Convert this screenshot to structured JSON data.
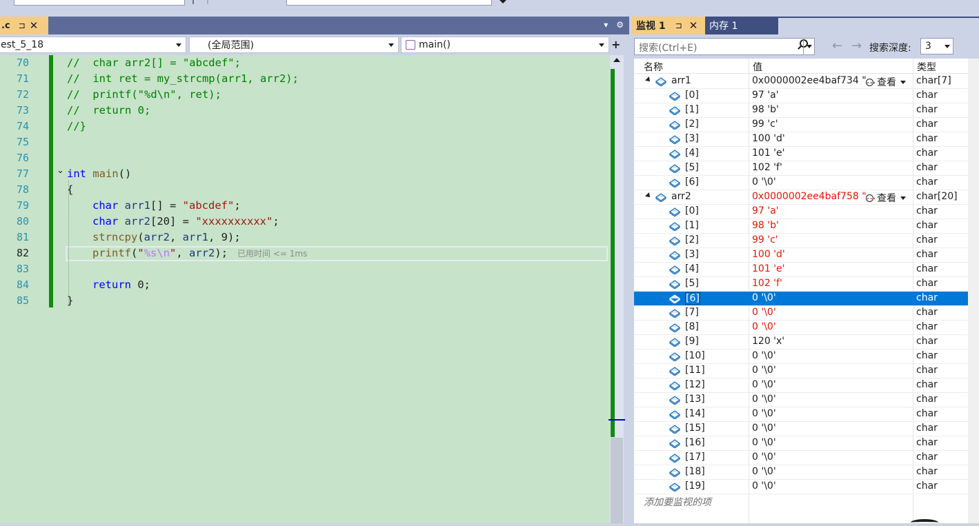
{
  "editor": {
    "file_tab": ".c",
    "nav_project": "est_5_18",
    "nav_scope": "(全局范围)",
    "nav_function": "main()",
    "lines": [
      {
        "n": "70",
        "text": "//  char arr2[] = \"abcdef\";"
      },
      {
        "n": "71",
        "text": "//  int ret = my_strcmp(arr1, arr2);"
      },
      {
        "n": "72",
        "text": "//  printf(\"%d\\n\", ret);"
      },
      {
        "n": "73",
        "text": "//  return 0;"
      },
      {
        "n": "74",
        "text": "//}"
      },
      {
        "n": "75",
        "text": ""
      },
      {
        "n": "76",
        "text": ""
      },
      {
        "n": "77",
        "text": "int main()"
      },
      {
        "n": "78",
        "text": "{"
      },
      {
        "n": "79",
        "text": "char arr1[] = \"abcdef\";"
      },
      {
        "n": "80",
        "text": "char arr2[20] = \"xxxxxxxxxx\";"
      },
      {
        "n": "81",
        "text": "strncpy(arr2, arr1, 9);"
      },
      {
        "n": "82",
        "text": "printf(\"%s\\n\", arr2);"
      },
      {
        "n": "83",
        "text": ""
      },
      {
        "n": "84",
        "text": "return 0;"
      },
      {
        "n": "85",
        "text": "}"
      }
    ],
    "elapsed_hint": "已用时间 <= 1ms"
  },
  "watch": {
    "tab_label": "监视 1",
    "memory_tab_label": "内存 1",
    "search_placeholder": "搜索(Ctrl+E)",
    "depth_label": "搜索深度:",
    "depth_value": "3",
    "headers": {
      "name": "名称",
      "value": "值",
      "type": "类型"
    },
    "view_label": "查看",
    "add_watch": "添加要监视的项",
    "rows": [
      {
        "name": "arr1",
        "value": "0x0000002ee4baf734 \"…",
        "type": "char[7]",
        "level": 0,
        "changed": false,
        "view": true
      },
      {
        "name": "[0]",
        "value": "97 'a'",
        "type": "char",
        "level": 1,
        "changed": false
      },
      {
        "name": "[1]",
        "value": "98 'b'",
        "type": "char",
        "level": 1,
        "changed": false
      },
      {
        "name": "[2]",
        "value": "99 'c'",
        "type": "char",
        "level": 1,
        "changed": false
      },
      {
        "name": "[3]",
        "value": "100 'd'",
        "type": "char",
        "level": 1,
        "changed": false
      },
      {
        "name": "[4]",
        "value": "101 'e'",
        "type": "char",
        "level": 1,
        "changed": false
      },
      {
        "name": "[5]",
        "value": "102 'f'",
        "type": "char",
        "level": 1,
        "changed": false
      },
      {
        "name": "[6]",
        "value": "0 '\\0'",
        "type": "char",
        "level": 1,
        "changed": false
      },
      {
        "name": "arr2",
        "value": "0x0000002ee4baf758 \"…",
        "type": "char[20]",
        "level": 0,
        "changed": true,
        "view": true
      },
      {
        "name": "[0]",
        "value": "97 'a'",
        "type": "char",
        "level": 1,
        "changed": true
      },
      {
        "name": "[1]",
        "value": "98 'b'",
        "type": "char",
        "level": 1,
        "changed": true
      },
      {
        "name": "[2]",
        "value": "99 'c'",
        "type": "char",
        "level": 1,
        "changed": true
      },
      {
        "name": "[3]",
        "value": "100 'd'",
        "type": "char",
        "level": 1,
        "changed": true
      },
      {
        "name": "[4]",
        "value": "101 'e'",
        "type": "char",
        "level": 1,
        "changed": true
      },
      {
        "name": "[5]",
        "value": "102 'f'",
        "type": "char",
        "level": 1,
        "changed": true
      },
      {
        "name": "[6]",
        "value": "0 '\\0'",
        "type": "char",
        "level": 1,
        "changed": true,
        "selected": true
      },
      {
        "name": "[7]",
        "value": "0 '\\0'",
        "type": "char",
        "level": 1,
        "changed": true
      },
      {
        "name": "[8]",
        "value": "0 '\\0'",
        "type": "char",
        "level": 1,
        "changed": true
      },
      {
        "name": "[9]",
        "value": "120 'x'",
        "type": "char",
        "level": 1,
        "changed": false
      },
      {
        "name": "[10]",
        "value": "0 '\\0'",
        "type": "char",
        "level": 1,
        "changed": false
      },
      {
        "name": "[11]",
        "value": "0 '\\0'",
        "type": "char",
        "level": 1,
        "changed": false
      },
      {
        "name": "[12]",
        "value": "0 '\\0'",
        "type": "char",
        "level": 1,
        "changed": false
      },
      {
        "name": "[13]",
        "value": "0 '\\0'",
        "type": "char",
        "level": 1,
        "changed": false
      },
      {
        "name": "[14]",
        "value": "0 '\\0'",
        "type": "char",
        "level": 1,
        "changed": false
      },
      {
        "name": "[15]",
        "value": "0 '\\0'",
        "type": "char",
        "level": 1,
        "changed": false
      },
      {
        "name": "[16]",
        "value": "0 '\\0'",
        "type": "char",
        "level": 1,
        "changed": false
      },
      {
        "name": "[17]",
        "value": "0 '\\0'",
        "type": "char",
        "level": 1,
        "changed": false
      },
      {
        "name": "[18]",
        "value": "0 '\\0'",
        "type": "char",
        "level": 1,
        "changed": false
      },
      {
        "name": "[19]",
        "value": "0 '\\0'",
        "type": "char",
        "level": 1,
        "changed": false
      }
    ]
  },
  "colors": {
    "accent": "#f5cc84",
    "selection": "#0078d7",
    "changed_value": "#e51400",
    "editor_bg": "#c7e3c9"
  }
}
